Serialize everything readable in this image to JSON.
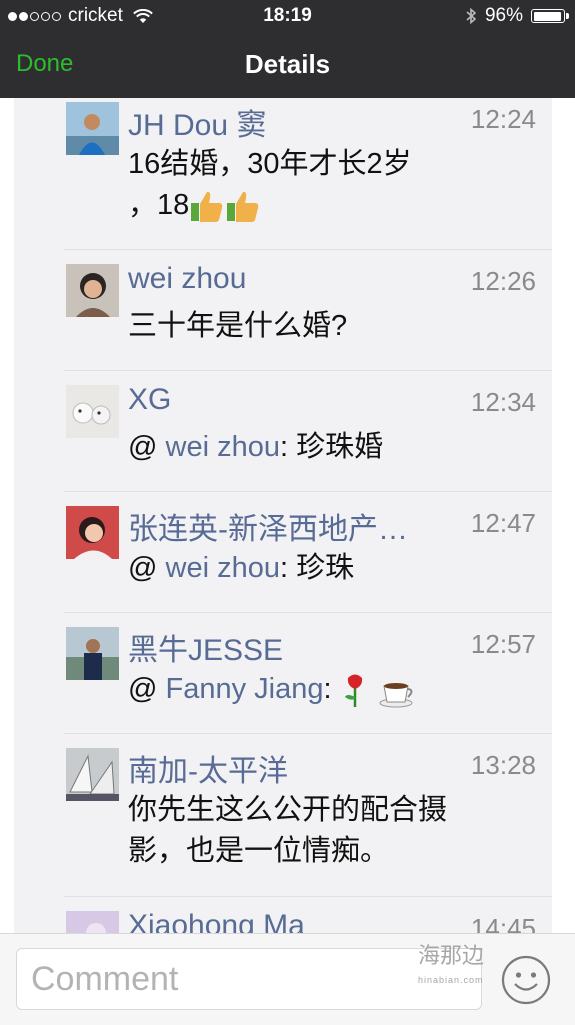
{
  "status": {
    "carrier": "cricket",
    "time": "18:19",
    "battery": "96%",
    "battery_level": 0.96
  },
  "nav": {
    "back": "Done",
    "title": "Details"
  },
  "comments": [
    {
      "name": "JH Dou 窦",
      "time": "12:24",
      "line1": "16结婚，30年才长2岁",
      "line2": "，18"
    },
    {
      "name": "wei zhou",
      "time": "12:26",
      "text": "三十年是什么婚?"
    },
    {
      "name": "XG",
      "time": "12:34",
      "at": "@ ",
      "mention": "wei zhou",
      "rest": ": 珍珠婚"
    },
    {
      "name": "张连英-新泽西地产…",
      "time": "12:47",
      "at": "@ ",
      "mention": "wei zhou",
      "rest": ": 珍珠"
    },
    {
      "name": "黑牛JESSE",
      "time": "12:57",
      "at": "@ ",
      "mention": "Fanny Jiang",
      "rest": ": "
    },
    {
      "name": "南加-太平洋",
      "time": "13:28",
      "line1": "你先生这么公开的配合摄",
      "line2": "影，也是一位情痴。"
    },
    {
      "name": "Xiaohong Ma",
      "time": "14:45"
    }
  ],
  "input": {
    "placeholder": "Comment"
  },
  "watermark": {
    "main": "海那边",
    "sub": "hinabian.com"
  },
  "colors": {
    "nav_bg": "#2e2e31",
    "accent_green": "#2bbd2b",
    "name_blue": "#576b95"
  },
  "icons": [
    "thumbs-up-icon",
    "rose-icon",
    "coffee-icon",
    "emoji-icon",
    "wifi-icon",
    "bluetooth-icon",
    "battery-icon"
  ]
}
